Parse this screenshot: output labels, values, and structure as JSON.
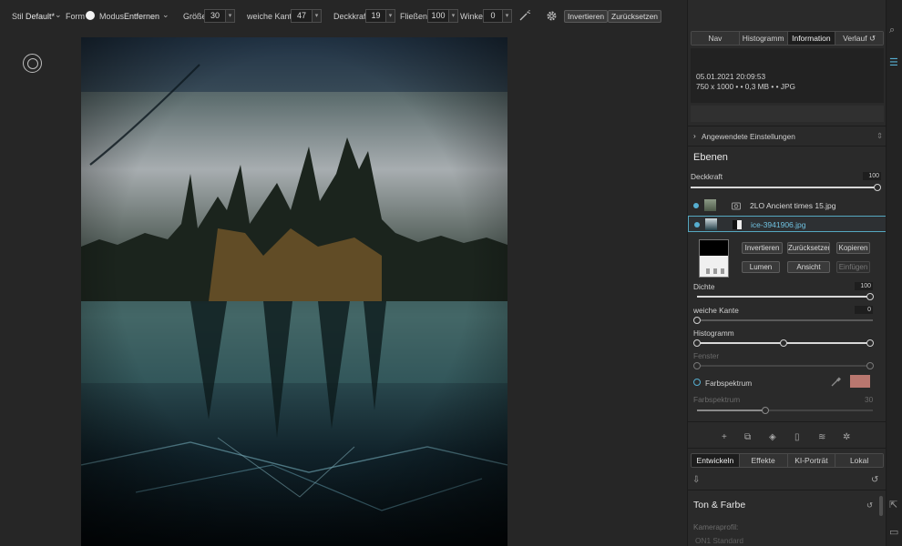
{
  "toolbar": {
    "stil_label": "Stil",
    "stil_value": "Default*",
    "form_label": "Form",
    "modus_label": "Modus",
    "modus_value": "Entfernen",
    "groesse_label": "Größe",
    "groesse_value": "30",
    "kante_label": "weiche Kante",
    "kante_value": "47",
    "deckkraft_label": "Deckkraft",
    "deckkraft_value": "19",
    "fliessen_label": "Fließen",
    "fliessen_value": "100",
    "winkel_label": "Winkel",
    "winkel_value": "0",
    "invert_button": "Invertieren",
    "reset_button": "Zurücksetzen"
  },
  "panel": {
    "tabs": [
      "Nav",
      "Histogramm",
      "Information",
      "Verlauf"
    ],
    "active_tab": "Information",
    "info": {
      "datetime": "05.01.2021 20:09:53",
      "meta": "750 x 1000 • • 0,3 MB • • JPG"
    },
    "applied_settings": "Angewendete Einstellungen",
    "layers_title": "Ebenen",
    "opacity_label": "Deckkraft",
    "opacity_value": "100",
    "layers": [
      {
        "name": "2LO Ancient times 15.jpg",
        "selected": false
      },
      {
        "name": "ice-3941906.jpg",
        "selected": true
      }
    ],
    "mask_buttons": {
      "invert": "Invertieren",
      "reset": "Zurücksetzen",
      "copy": "Kopieren",
      "lumen": "Lumen",
      "view": "Ansicht",
      "paste": "Einfügen"
    },
    "density_label": "Dichte",
    "density_value": "100",
    "feather_label": "weiche Kante",
    "feather_value": "0",
    "histogram_label": "Histogramm",
    "window_label": "Fenster",
    "color_range_label": "Farbspektrum",
    "color_range_sub_label": "Farbspektrum",
    "color_range_sub_value": "30",
    "swatch_color": "#b9776f",
    "bottom_tabs": [
      "Entwickeln",
      "Effekte",
      "KI-Porträt",
      "Lokal"
    ],
    "active_bottom_tab": "Entwickeln",
    "tone_title": "Ton & Farbe",
    "camera_profile_label": "Kameraprofil:",
    "camera_profile_value": "ON1 Standard"
  },
  "colors": {
    "accent": "#56aed0",
    "panel_bg": "#2a2a2a",
    "app_bg": "#262626"
  }
}
